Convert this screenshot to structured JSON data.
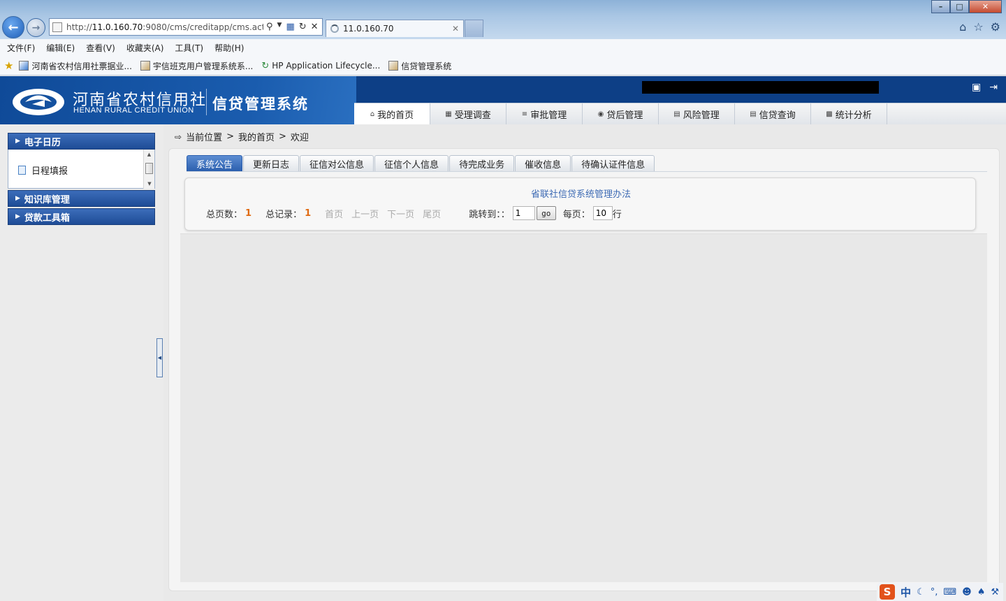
{
  "browser": {
    "url_prefix": "http://",
    "url_host": "11.0.160.70",
    "url_rest": ":9080/cms/creditapp/cms.actic",
    "tab_title": "11.0.160.70",
    "menu": [
      "文件(F)",
      "编辑(E)",
      "查看(V)",
      "收藏夹(A)",
      "工具(T)",
      "帮助(H)"
    ],
    "favorites": [
      "河南省农村信用社票据业...",
      "宇信班克用户管理系统系...",
      "HP Application Lifecycle...",
      "信贷管理系统"
    ]
  },
  "header": {
    "logo_cn": "河南省农村信用社",
    "logo_en": "HENAN RURAL CREDIT UNION",
    "system_name": "信贷管理系统",
    "nav": [
      "我的首页",
      "受理调查",
      "审批管理",
      "贷后管理",
      "风险管理",
      "信贷查询",
      "统计分析"
    ]
  },
  "sidebar": {
    "sections": [
      {
        "label": "电子日历",
        "expanded": true,
        "items": [
          "日程填报"
        ]
      },
      {
        "label": "知识库管理",
        "expanded": false
      },
      {
        "label": "贷款工具箱",
        "expanded": false
      }
    ]
  },
  "breadcrumb": {
    "label": "当前位置",
    "path": [
      "我的首页",
      "欢迎"
    ],
    "sep": ">"
  },
  "subtabs": [
    "系统公告",
    "更新日志",
    "征信对公信息",
    "征信个人信息",
    "待完成业务",
    "催收信息",
    "待确认证件信息"
  ],
  "notice": {
    "title": "省联社信贷系统管理办法"
  },
  "pager": {
    "total_pages_label": "总页数：",
    "total_pages": "1",
    "total_records_label": "总记录：",
    "total_records": "1",
    "first": "首页",
    "prev": "上一页",
    "next": "下一页",
    "last": "尾页",
    "jump_label": "跳转到：：",
    "jump_value": "1",
    "go": "go",
    "per_page_label": "每页：",
    "per_page_value": "10",
    "per_page_unit": "行"
  },
  "ime": {
    "mode": "中",
    "logo": "S"
  }
}
